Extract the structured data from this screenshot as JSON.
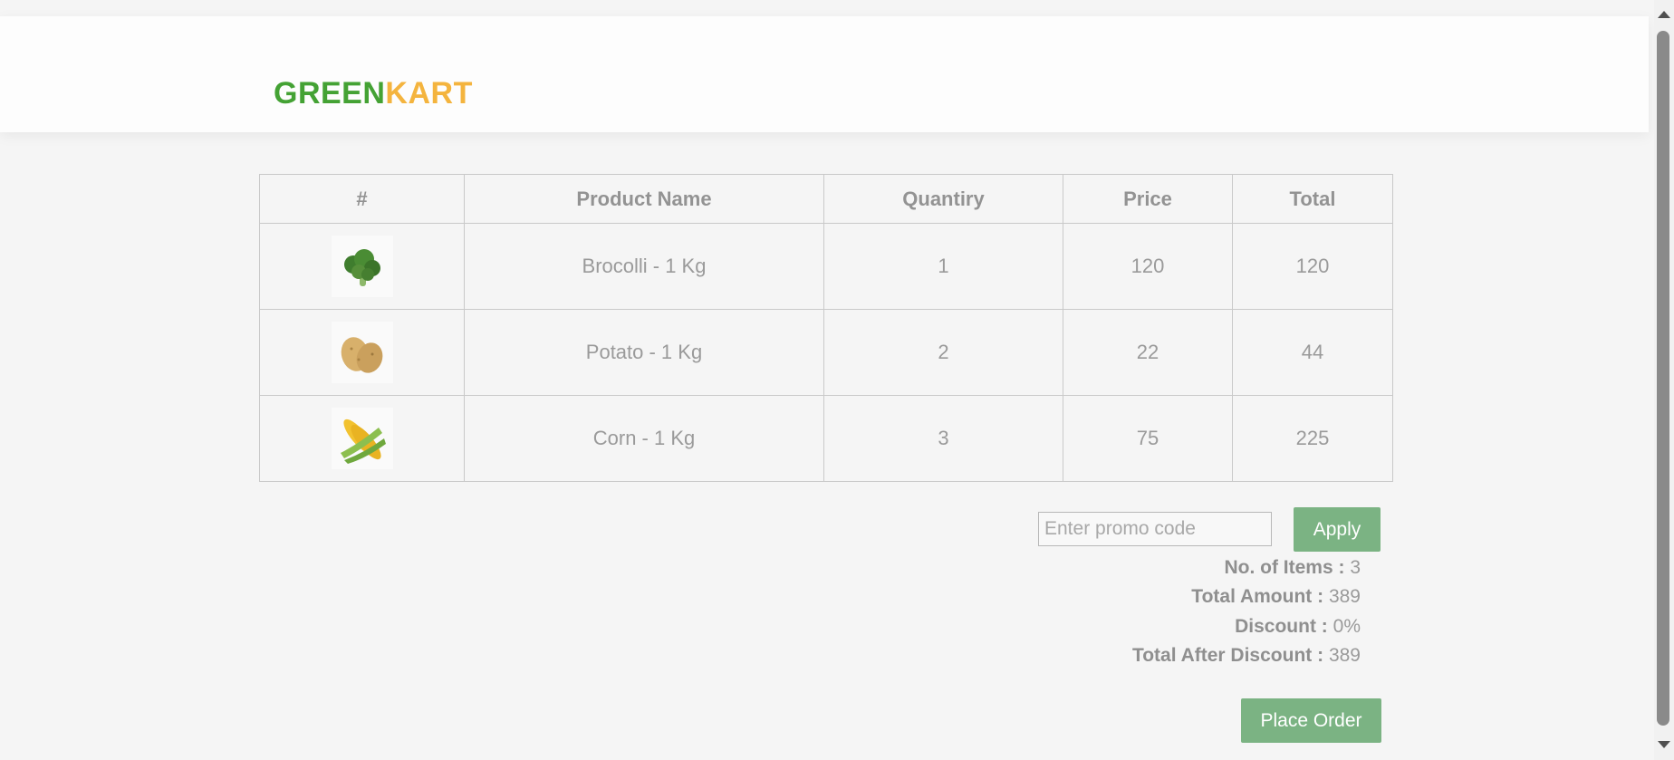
{
  "brand": {
    "part1": "GREEN",
    "part2": "KART"
  },
  "table": {
    "headers": [
      "#",
      "Product Name",
      "Quantiry",
      "Price",
      "Total"
    ],
    "rows": [
      {
        "image": "broccoli-image",
        "name": "Brocolli - 1 Kg",
        "quantity": "1",
        "price": "120",
        "total": "120"
      },
      {
        "image": "potato-image",
        "name": "Potato - 1 Kg",
        "quantity": "2",
        "price": "22",
        "total": "44"
      },
      {
        "image": "corn-image",
        "name": "Corn - 1 Kg",
        "quantity": "3",
        "price": "75",
        "total": "225"
      }
    ]
  },
  "promo": {
    "placeholder": "Enter promo code",
    "apply_label": "Apply"
  },
  "summary": {
    "items_label": "No. of Items :",
    "items_value": "3",
    "amount_label": "Total Amount :",
    "amount_value": "389",
    "discount_label": "Discount :",
    "discount_value": "0%",
    "after_label": "Total After Discount :",
    "after_value": "389"
  },
  "place_order_label": "Place Order",
  "colors": {
    "brand_green": "#44a234",
    "brand_orange": "#f4b43e",
    "button": "#7bb383"
  }
}
